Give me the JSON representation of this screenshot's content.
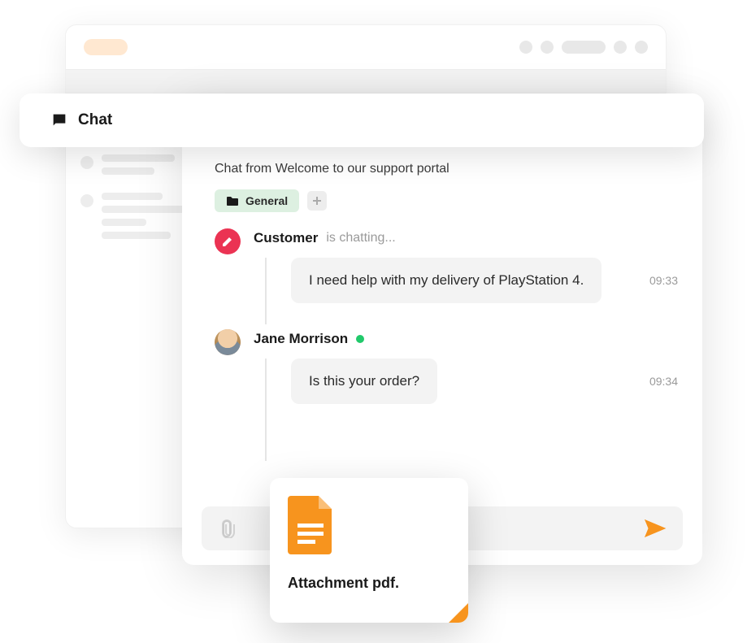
{
  "header": {
    "chat_label": "Chat"
  },
  "tab": {
    "title": "Chat from Welcom..."
  },
  "subject": "Chat from Welcome to our support portal",
  "tag": {
    "label": "General"
  },
  "messages": [
    {
      "sender": "Customer",
      "status": "is chatting...",
      "avatar_type": "edit",
      "bubbles": [
        {
          "text": "I need help with my delivery of PlayStation 4.",
          "time": "09:33"
        }
      ]
    },
    {
      "sender": "Jane Morrison",
      "online": true,
      "avatar_type": "photo",
      "bubbles": [
        {
          "text": "Is this your order?",
          "time": "09:34"
        }
      ]
    }
  ],
  "attachment": {
    "label": "Attachment pdf."
  },
  "colors": {
    "accent": "#F7941E",
    "danger": "#EB3353",
    "success": "#21C96B",
    "tag_bg": "#DDF0E1"
  }
}
